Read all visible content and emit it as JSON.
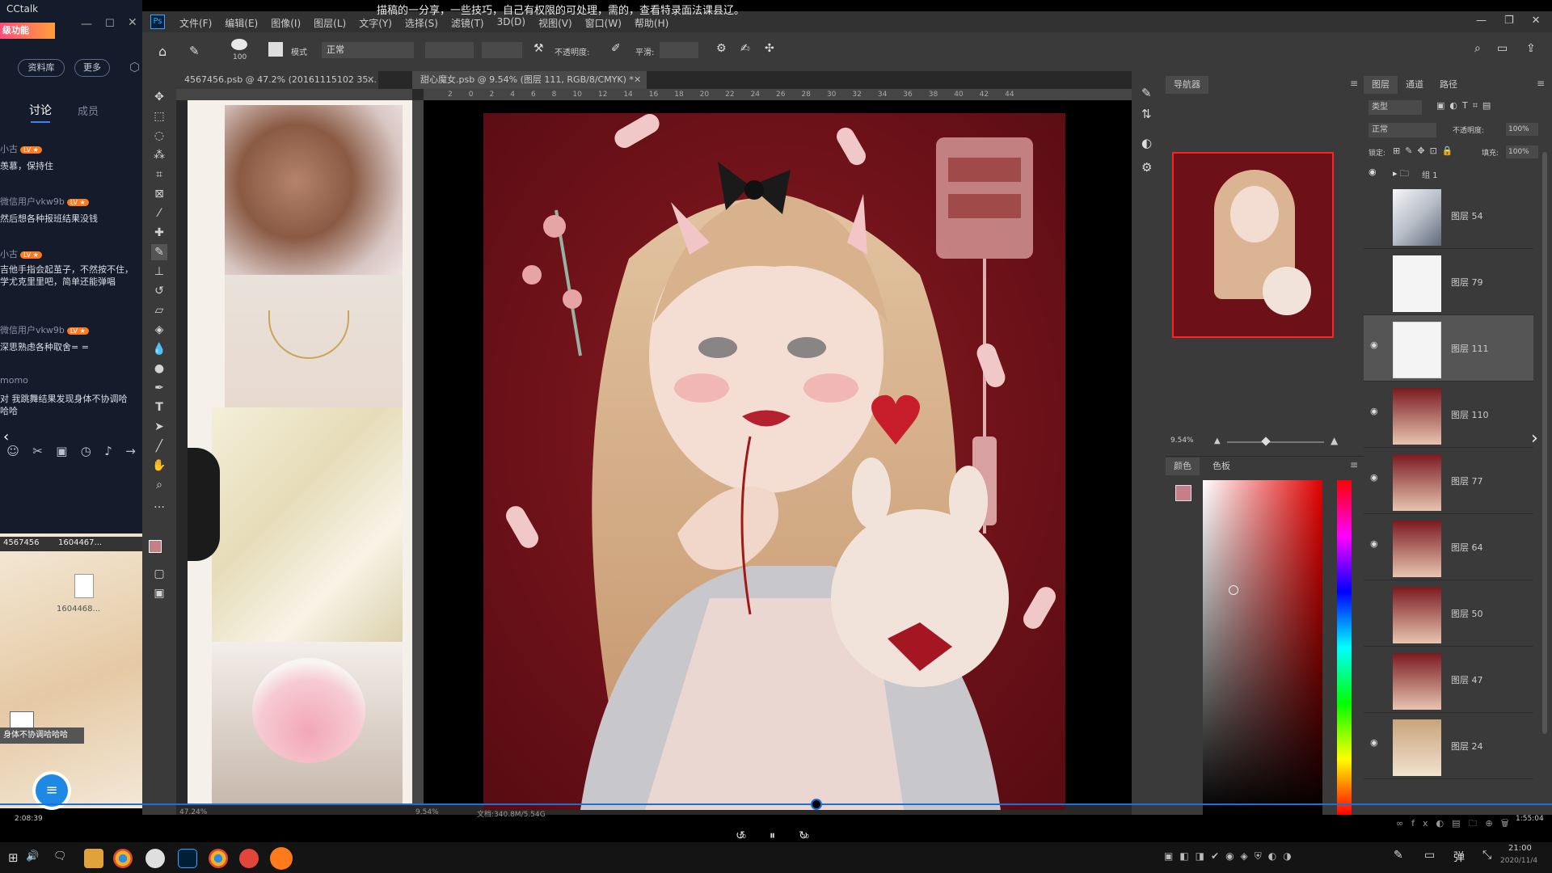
{
  "chat": {
    "brand": "CCtalk",
    "banner": "级功能",
    "btn_library": "资料库",
    "btn_more": "更多",
    "tab_discuss": "讨论",
    "tab_members": "成员",
    "messages": [
      {
        "name": "小古",
        "text": "羡慕，保持住"
      },
      {
        "name": "微信用户vkw9b",
        "text": "然后想各种报班结果没钱"
      },
      {
        "name": "小古",
        "text": "吉他手指会起茧子，不然按不住，学尤克里里吧，简单还能弹唱"
      },
      {
        "name": "微信用户vkw9b",
        "text": "深思熟虑各种取舍= ="
      },
      {
        "name": "momo",
        "text": "对 我跳舞结果发现身体不协调哈哈哈"
      }
    ],
    "file1": "4567456",
    "file2": "1604467...",
    "file3": "1604468...",
    "bubble": "身体不协调哈哈哈"
  },
  "ps": {
    "menu": [
      "文件(F)",
      "编辑(E)",
      "图像(I)",
      "图层(L)",
      "文字(Y)",
      "选择(S)",
      "滤镜(T)",
      "3D(D)",
      "视图(V)",
      "窗口(W)",
      "帮助(H)"
    ],
    "title_overlay": "描稿的一分享，一些技巧，自己有权限的可处理，需的，查看特录面法课县辽。",
    "options": {
      "brush_size": "100",
      "mode_label": "模式",
      "mode_value": "正常",
      "opacity_label": "不透明度:",
      "flow_label": "平滑:"
    },
    "tab_doc1": "4567456.psb @ 47.2% (20161115102 35...",
    "tab_doc2": "甜心魔女.psb @ 9.54% (图层 111, RGB/8/CMYK) *",
    "ruler_marks": [
      "2",
      "0",
      "2",
      "4",
      "6",
      "8",
      "10",
      "12",
      "14",
      "16",
      "18",
      "20",
      "22",
      "24",
      "26",
      "28",
      "30",
      "32",
      "34",
      "36",
      "38",
      "40",
      "42",
      "44"
    ],
    "zoom_left": "47.24%",
    "zoom_doc": "9.54%",
    "doc_info": "文档:340.8M/5.54G",
    "navigator_title": "导航器",
    "navigator_zoom": "9.54%",
    "color_tab": "颜色",
    "swatch_tab": "色板",
    "layers_tabs": [
      "图层",
      "通道",
      "路径"
    ],
    "layers_kind": "类型",
    "blend_mode": "正常",
    "opacity_label": "不透明度:",
    "opacity_value": "100%",
    "lock_label": "锁定:",
    "fill_label": "填充:",
    "fill_value": "100%",
    "group_name": "组 1",
    "layers": [
      "图层 54",
      "图层 79",
      "图层 111",
      "图层 110",
      "图层 77",
      "图层 64",
      "图层 50",
      "图层 47",
      "图层 24"
    ]
  },
  "video": {
    "elapsed": "2:08:39",
    "total": "1:55:04",
    "back_label": "10",
    "fwd_label": "30"
  },
  "taskbar": {
    "time": "21:00",
    "date": "2020/11/4"
  }
}
